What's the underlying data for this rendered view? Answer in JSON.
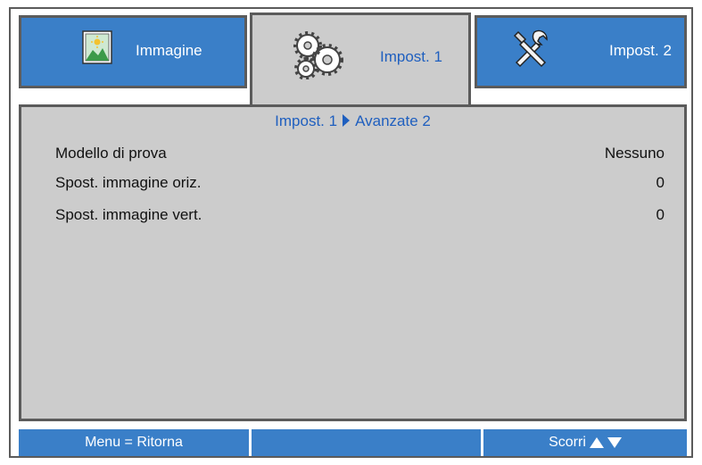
{
  "tabs": {
    "immagine": {
      "label": "Immagine",
      "icon": "picture-icon"
    },
    "impost1": {
      "label": "Impost. 1",
      "icon": "gears-icon"
    },
    "impost2": {
      "label": "Impost. 2",
      "icon": "tools-icon"
    }
  },
  "breadcrumb": {
    "parent": "Impost. 1",
    "current": "Avanzate 2"
  },
  "settings": [
    {
      "label": "Modello di prova",
      "value": "Nessuno"
    },
    {
      "label": "Spost. immagine oriz.",
      "value": "0"
    },
    {
      "label": "Spost. immagine vert.",
      "value": "0"
    }
  ],
  "footer": {
    "back": "Menu = Ritorna",
    "middle": "",
    "scroll": "Scorri"
  },
  "colors": {
    "tab_blue": "#3a7fc8",
    "panel_gray": "#cccccc",
    "accent_text": "#1f5fbf",
    "border": "#5b5b5b"
  }
}
